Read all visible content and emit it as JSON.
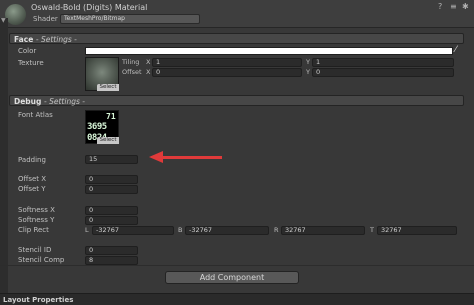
{
  "header": {
    "title": "Oswald-Bold (Digits) Material",
    "shader_label": "Shader",
    "shader_value": "TextMeshPro/Bitmap",
    "icons": [
      "help-icon",
      "settings-icon",
      "gear-icon"
    ]
  },
  "face": {
    "title": "Face",
    "subtitle": "- Settings -",
    "color_label": "Color",
    "color_value": "#ffffff",
    "texture_label": "Texture",
    "select_label": "Select",
    "tiling_label": "Tiling",
    "offset_label": "Offset",
    "tiling_x_label": "X",
    "tiling_x": "1",
    "tiling_y_label": "Y",
    "tiling_y": "1",
    "offset_x_label": "X",
    "offset_x": "0",
    "offset_y_label": "Y",
    "offset_y": "0"
  },
  "debug": {
    "title": "Debug",
    "subtitle": "- Settings -",
    "font_atlas_label": "Font Atlas",
    "atlas_glyphs_row1": "71",
    "atlas_glyphs_row2": "3695",
    "atlas_glyphs_row3": "0824",
    "atlas_select_label": "Select",
    "padding_label": "Padding",
    "padding_value": "15",
    "offset_x_label": "Offset X",
    "offset_x": "0",
    "offset_y_label": "Offset Y",
    "offset_y": "0",
    "softness_x_label": "Softness X",
    "softness_x": "0",
    "softness_y_label": "Softness Y",
    "softness_y": "0",
    "clip_rect_label": "Clip Rect",
    "clip_l_label": "L",
    "clip_l": "-32767",
    "clip_b_label": "B",
    "clip_b": "-32767",
    "clip_r_label": "R",
    "clip_r": "32767",
    "clip_t_label": "T",
    "clip_t": "32767",
    "stencil_id_label": "Stencil ID",
    "stencil_id": "0",
    "stencil_comp_label": "Stencil Comp",
    "stencil_comp": "8"
  },
  "add_component_label": "Add Component",
  "bottom_label": "Layout Properties",
  "colors": {
    "annotation_arrow": "#e03a3a",
    "background": "#383838"
  }
}
